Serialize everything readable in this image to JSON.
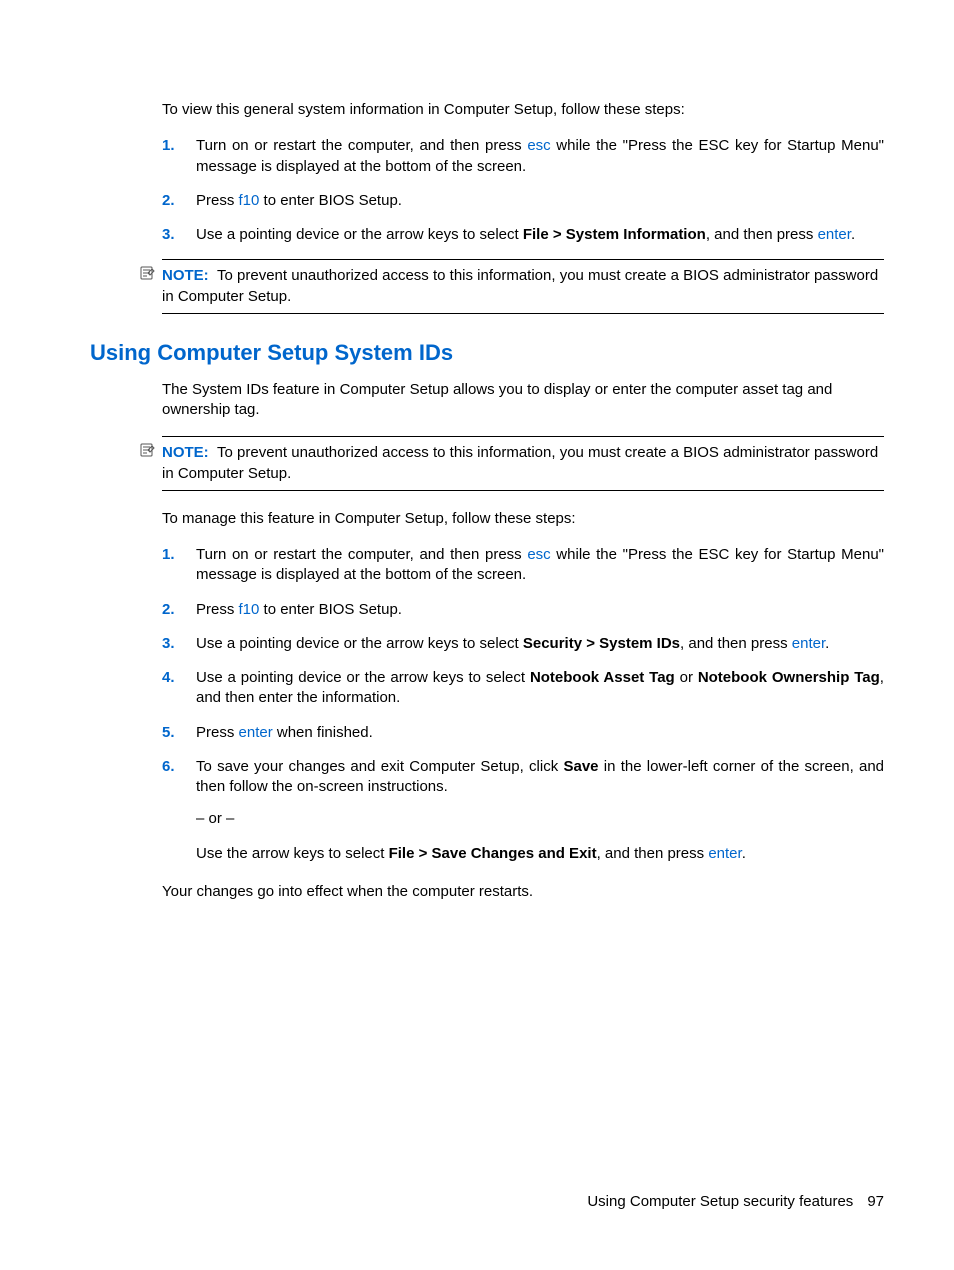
{
  "intro1": "To view this general system information in Computer Setup, follow these steps:",
  "listA": {
    "n1": "1.",
    "i1a": "Turn on or restart the computer, and then press ",
    "i1_key": "esc",
    "i1b": " while the \"Press the ESC key for Startup Menu\" message is displayed at the bottom of the screen.",
    "n2": "2.",
    "i2a": "Press ",
    "i2_key": "f10",
    "i2b": " to enter BIOS Setup.",
    "n3": "3.",
    "i3a": "Use a pointing device or the arrow keys to select ",
    "i3_bold": "File > System Information",
    "i3b": ", and then press ",
    "i3_key": "enter",
    "i3c": "."
  },
  "note1": {
    "label": "NOTE:",
    "text": "To prevent unauthorized access to this information, you must create a BIOS administrator password in Computer Setup."
  },
  "heading": "Using Computer Setup System IDs",
  "para2": "The System IDs feature in Computer Setup allows you to display or enter the computer asset tag and ownership tag.",
  "note2": {
    "label": "NOTE:",
    "text": "To prevent unauthorized access to this information, you must create a BIOS administrator password in Computer Setup."
  },
  "para3": "To manage this feature in Computer Setup, follow these steps:",
  "listB": {
    "n1": "1.",
    "i1a": "Turn on or restart the computer, and then press ",
    "i1_key": "esc",
    "i1b": " while the \"Press the ESC key for Startup Menu\" message is displayed at the bottom of the screen.",
    "n2": "2.",
    "i2a": "Press ",
    "i2_key": "f10",
    "i2b": " to enter BIOS Setup.",
    "n3": "3.",
    "i3a": "Use a pointing device or the arrow keys to select ",
    "i3_bold": "Security > System IDs",
    "i3b": ", and then press ",
    "i3_key": "enter",
    "i3c": ".",
    "n4": "4.",
    "i4a": "Use a pointing device or the arrow keys to select ",
    "i4_bold1": "Notebook Asset Tag",
    "i4_or": " or ",
    "i4_bold2": "Notebook Ownership Tag",
    "i4b": ", and then enter the information.",
    "n5": "5.",
    "i5a": "Press ",
    "i5_key": "enter",
    "i5b": " when finished.",
    "n6": "6.",
    "i6a": "To save your changes and exit Computer Setup, click ",
    "i6_bold": "Save",
    "i6b": " in the lower-left corner of the screen, and then follow the on-screen instructions.",
    "i6_or": "– or –",
    "i6c": "Use the arrow keys to select ",
    "i6_bold2": "File > Save Changes and Exit",
    "i6d": ", and then press ",
    "i6_key": "enter",
    "i6e": "."
  },
  "closing": "Your changes go into effect when the computer restarts.",
  "footer": {
    "text": "Using Computer Setup security features",
    "page": "97"
  }
}
